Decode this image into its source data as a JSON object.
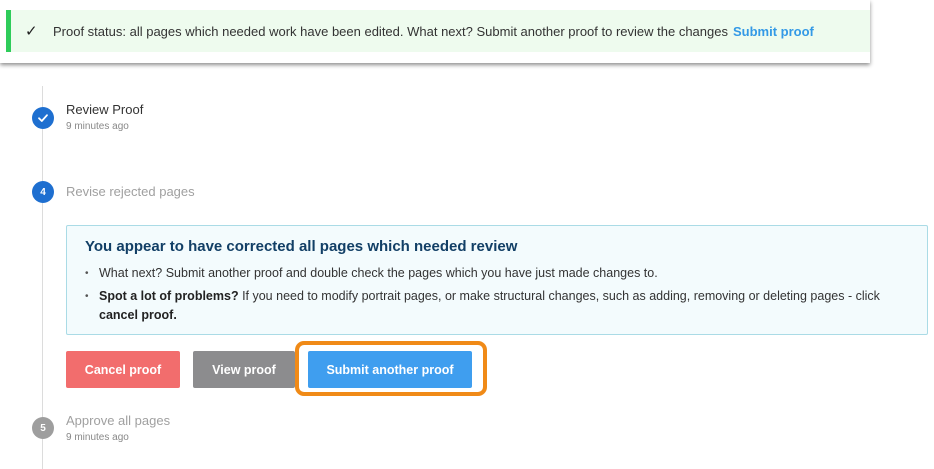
{
  "banner": {
    "icon": "check-icon",
    "text": "Proof status: all pages which needed work have been edited. What next? Submit another proof to review the changes",
    "link": "Submit proof"
  },
  "steps": [
    {
      "number": "",
      "icon": "check-icon",
      "title": "Review Proof",
      "time": "9 minutes ago",
      "state": "done"
    },
    {
      "number": "4",
      "title": "Revise rejected pages",
      "state": "active"
    },
    {
      "number": "5",
      "title": "Approve all pages",
      "time": "9 minutes ago",
      "state": "pending"
    }
  ],
  "info": {
    "heading": "You appear to have corrected all pages which needed review",
    "bullet1": "What next? Submit another proof and double check the pages which you have just made changes to.",
    "bullet2_bold": "Spot a lot of problems?",
    "bullet2_text": " If you need to modify portrait pages, or make structural changes, such as adding, removing or deleting pages - click ",
    "bullet2_link": "cancel proof."
  },
  "buttons": {
    "cancel": "Cancel proof",
    "view": "View proof",
    "submit": "Submit another proof"
  },
  "colors": {
    "banner_bg": "#eefbee",
    "banner_accent": "#2ecc5a",
    "step_blue": "#1e6fd0",
    "cancel": "#f26d6d",
    "view": "#8c8c8e",
    "submit": "#3f9eef",
    "highlight": "#f08a17"
  }
}
